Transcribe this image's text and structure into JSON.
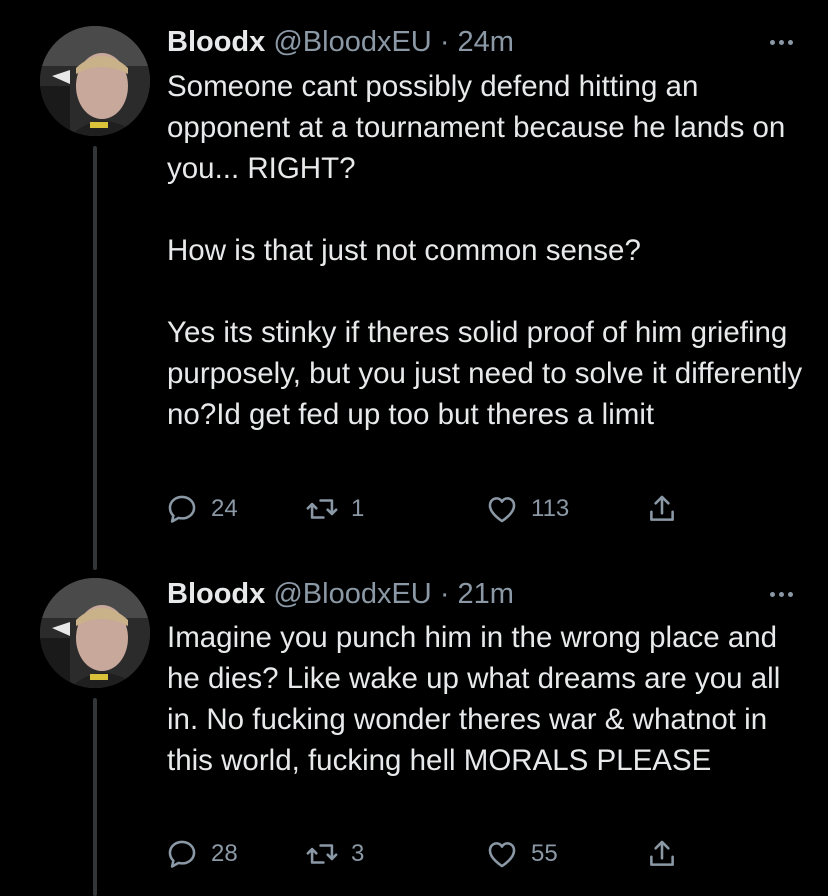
{
  "tweets": [
    {
      "name": "Bloodx",
      "handle": "@BloodxEU",
      "dot": "·",
      "time": "24m",
      "text": "Someone cant possibly defend hitting an opponent at a tournament because he lands on you... RIGHT?\n\nHow is that just not common sense?\n\nYes its stinky if theres solid proof of him griefing purposely, but you just need to solve it differently no?Id get fed up too but theres a limit",
      "replies": "24",
      "retweets": "1",
      "likes": "113"
    },
    {
      "name": "Bloodx",
      "handle": "@BloodxEU",
      "dot": "·",
      "time": "21m",
      "text": "Imagine you punch him in the wrong place and he dies? Like wake up what dreams are you all in. No fucking wonder theres war & whatnot in this world, fucking hell MORALS PLEASE",
      "replies": "28",
      "retweets": "3",
      "likes": "55"
    }
  ],
  "icons": {
    "reply": "reply-icon",
    "retweet": "retweet-icon",
    "like": "heart-icon",
    "share": "share-icon",
    "more": "more-icon"
  },
  "colors": {
    "background": "#000000",
    "text": "#e7e9ea",
    "secondary": "#8b98a5",
    "thread_line": "#333639"
  }
}
